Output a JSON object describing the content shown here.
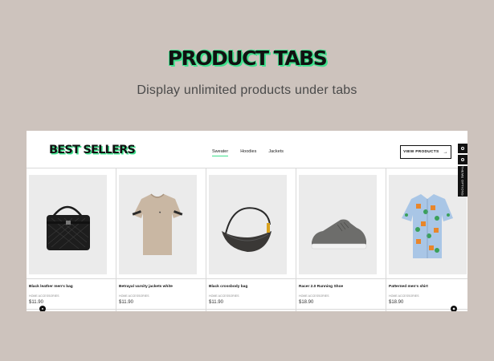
{
  "hero": {
    "title": "PRODUCT TABS",
    "subtitle": "Display unlimited  products under tabs"
  },
  "section": {
    "heading": "BEST SELLERS",
    "tabs": [
      {
        "label": "Sweater",
        "active": true
      },
      {
        "label": "Hoodies",
        "active": false
      },
      {
        "label": "Jackets",
        "active": false
      }
    ],
    "view_button": "VIEW PRODUCTS",
    "theme_options": "THEME OPTIONS"
  },
  "products": [
    {
      "name": "Black leather men's bag",
      "category": "HOME ACCESSORIES",
      "price": "$11.90"
    },
    {
      "name": "Betrayal varsity jackets white",
      "category": "HOME ACCESSORIES",
      "price": "$11.90"
    },
    {
      "name": "Black crossbody bag",
      "category": "HOME ACCESSORIES",
      "price": "$11.90"
    },
    {
      "name": "Racer 2.0 Running Shoe",
      "category": "HOME ACCESSORIES",
      "price": "$18.90"
    },
    {
      "name": "Patterned men's shirt",
      "category": "HOME ACCESSORIES",
      "price": "$18.90"
    }
  ],
  "colors": {
    "background": "#cdc3bd",
    "accent": "#3fe08d",
    "ink": "#111111"
  },
  "icons": [
    "arrow-right-icon",
    "settings-icon",
    "chat-icon",
    "bag-image",
    "tshirt-image",
    "crossbody-bag-image",
    "sneaker-image",
    "shirt-image"
  ]
}
